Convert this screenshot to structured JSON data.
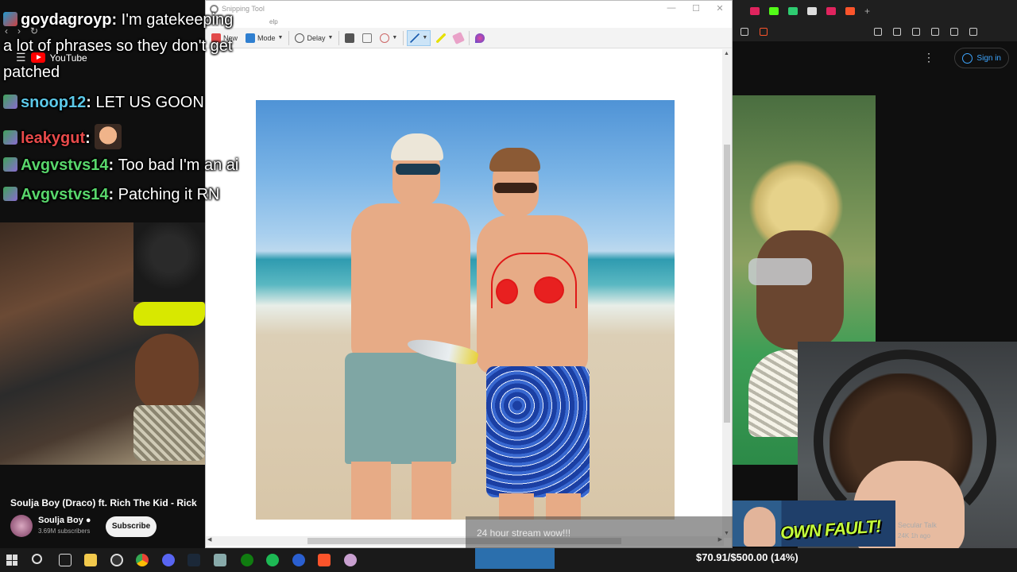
{
  "chat": [
    {
      "user": "goydagroyp",
      "message": "I'm gatekeeping",
      "user_color": "#ffffff"
    },
    {
      "continuation": "a lot of phrases so they don't get"
    },
    {
      "continuation": "patched"
    },
    {
      "user": "snoop12",
      "message": "LET US GOON",
      "user_color": "#5bc8e8"
    },
    {
      "user": "leakygut",
      "message": "",
      "user_color": "#e84a4a",
      "has_emote": true
    },
    {
      "user": "Avgvstvs14",
      "message": "Too bad I'm an ai",
      "user_color": "#58d66b"
    },
    {
      "user": "Avgvstvs14",
      "message": "Patching it RN",
      "user_color": "#58d66b"
    }
  ],
  "youtube_left": {
    "logo_text": "YouTube",
    "video_title": "Soulja Boy (Draco) ft. Rich The Kid - Rick",
    "channel": "Soulja Boy",
    "subscribers": "3.69M subscribers",
    "subscribe_label": "Subscribe"
  },
  "snipping_tool": {
    "title": "Snipping Tool",
    "menu_fragment": "elp",
    "toolbar": {
      "new_label": "New",
      "mode_label": "Mode",
      "delay_label": "Delay"
    }
  },
  "youtube_right": {
    "signin_label": "Sign in",
    "suggested": {
      "thumbnail_text": "OWN FAULT!",
      "channel": "Secular Talk",
      "meta": "24K  1h ago"
    }
  },
  "stream_overlay": {
    "message": "24 hour stream wow!!!",
    "goal_text": "$70.91/$500.00 (14%)",
    "goal_fraction": 0.14
  },
  "colors": {
    "accent_blue": "#3ea6ff",
    "youtube_red": "#ff0000",
    "chat_green": "#58d66b"
  },
  "icons": {
    "taskbar": [
      "windows-start-icon",
      "search-icon",
      "task-view-icon",
      "file-explorer-icon",
      "obs-icon",
      "chrome-icon",
      "discord-icon",
      "steam-icon",
      "app-icon",
      "xbox-icon",
      "spotify-icon",
      "ea-icon",
      "brave-icon",
      "app2-icon"
    ]
  }
}
